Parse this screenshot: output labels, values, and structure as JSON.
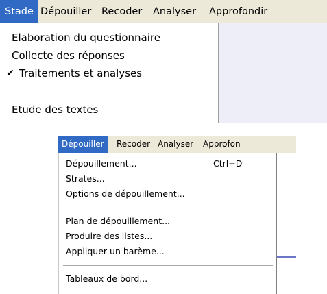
{
  "top_screenshot": {
    "menubar": {
      "items": [
        "Stade",
        "Dépouiller",
        "Recoder",
        "Analyser",
        "Approfondir"
      ],
      "active_index": 0
    },
    "dropdown": {
      "items": [
        {
          "label": "Elaboration du questionnaire",
          "checked": false
        },
        {
          "label": "Collecte des réponses",
          "checked": false
        },
        {
          "label": "Traitements et analyses",
          "checked": true
        },
        {
          "label": "Etude des textes",
          "checked": false
        }
      ],
      "check_glyph": "✔"
    }
  },
  "bottom_screenshot": {
    "menubar": {
      "items": [
        "Dépouiller",
        "Recoder",
        "Analyser",
        "Approfon"
      ],
      "active_index": 0
    },
    "dropdown": {
      "items": [
        {
          "label": "Dépouillement...",
          "shortcut": "Ctrl+D"
        },
        {
          "label": "Strates..."
        },
        {
          "label": "Options de dépouillement..."
        },
        {
          "label": "Plan de dépouillement..."
        },
        {
          "label": "Produire des listes..."
        },
        {
          "label": "Appliquer un barème..."
        },
        {
          "label": "Tableaux de bord..."
        }
      ]
    }
  },
  "colors": {
    "menu_highlight": "#316ac5",
    "menubar_bg": "#ece9d8",
    "menu_bg": "#ffffff"
  }
}
